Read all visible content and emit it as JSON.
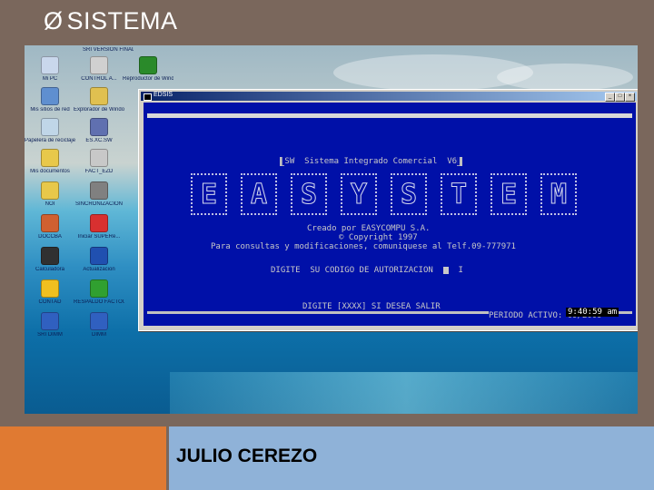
{
  "slide": {
    "title_arrow": "Ø",
    "title": "SISTEMA",
    "footer_name": "JULIO CEREZO"
  },
  "desktop": {
    "icons": [
      {
        "label": "Mi PC",
        "color": "#c9d7ec"
      },
      {
        "label": "CONTROL A...",
        "color": "#d0d0d0"
      },
      {
        "label": "Reproductor de Windows",
        "color": "#2a8a2a"
      },
      {
        "label": "Mis sitios de red",
        "color": "#5f8fd0"
      },
      {
        "label": "Explorador de Windows",
        "color": "#e0c050"
      },
      {
        "label": "Papelera de reciclaje",
        "color": "#c0d6e8"
      },
      {
        "label": "ES.XC.SW",
        "color": "#6070b0"
      },
      {
        "label": "Mis documentos",
        "color": "#e8c84a"
      },
      {
        "label": "FACT_EZD",
        "color": "#c8c8c8"
      },
      {
        "label": "NOI",
        "color": "#e8c84a"
      },
      {
        "label": "SINCRONIZACION",
        "color": "#808080"
      },
      {
        "label": "DOCCBA",
        "color": "#d06030"
      },
      {
        "label": "Iniciar SUPERe...",
        "color": "#d83030"
      },
      {
        "label": "Calculadora",
        "color": "#303030"
      },
      {
        "label": "Actualizacion",
        "color": "#2050b0"
      },
      {
        "label": "CONTAD",
        "color": "#f0c020"
      },
      {
        "label": "RESPALDO FACTOUTS",
        "color": "#30a030"
      },
      {
        "label": "SRI DIMM",
        "color": "#3060c0"
      },
      {
        "label": "DIMM",
        "color": "#3060c0"
      }
    ],
    "top_label": "SRI VERSION FINAL"
  },
  "dos_window": {
    "title": "EDSIS",
    "min_label": "_",
    "max_label": "□",
    "close_label": "×",
    "header_line": "SW  Sistema Integrado Comercial  V6",
    "banner_text": "EASYSTEM",
    "credit_1": "Creado por EASYCOMPU S.A.",
    "credit_2": "© Copyright 1997",
    "credit_3": "Para consultas y modificaciones, comuniquese al Telf.09-777971",
    "prompt": "DIGITE  SU CODIGO DE AUTORIZACION  ",
    "prompt_end": "  I",
    "bottom_prompt": "DIGITE [XXXX] SI DESEA SALIR",
    "period": "PERIODO ACTIVO: 09/2009",
    "time": "9:40:59 am"
  }
}
